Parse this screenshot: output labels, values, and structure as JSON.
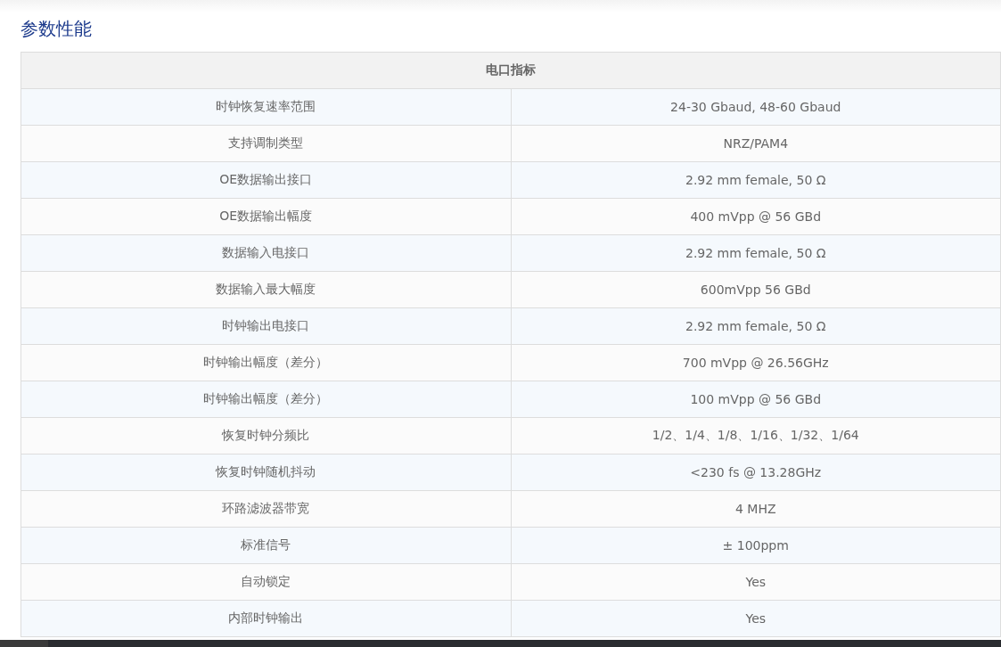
{
  "title": "参数性能",
  "table": {
    "header": "电口指标",
    "rows": [
      {
        "param": "时钟恢复速率范围",
        "value": "24-30 Gbaud, 48-60 Gbaud"
      },
      {
        "param": "支持调制类型",
        "value": "NRZ/PAM4"
      },
      {
        "param": "OE数据输出接口",
        "value": "2.92 mm female, 50 Ω"
      },
      {
        "param": "OE数据输出幅度",
        "value": "400 mVpp @ 56 GBd"
      },
      {
        "param": "数据输入电接口",
        "value": "2.92 mm female, 50 Ω"
      },
      {
        "param": "数据输入最大幅度",
        "value": "600mVpp 56 GBd"
      },
      {
        "param": "时钟输出电接口",
        "value": "2.92 mm female, 50 Ω"
      },
      {
        "param": "时钟输出幅度（差分）",
        "value": "700 mVpp @ 26.56GHz"
      },
      {
        "param": "时钟输出幅度（差分）",
        "value": "100 mVpp @ 56 GBd"
      },
      {
        "param": "恢复时钟分频比",
        "value": "1/2、1/4、1/8、1/16、1/32、1/64"
      },
      {
        "param": "恢复时钟随机抖动",
        "value": "<230 fs @ 13.28GHz"
      },
      {
        "param": "环路滤波器带宽",
        "value": "4 MHZ"
      },
      {
        "param": "标准信号",
        "value": "± 100ppm"
      },
      {
        "param": "自动锁定",
        "value": "Yes"
      },
      {
        "param": "内部时钟输出",
        "value": "Yes"
      }
    ]
  }
}
